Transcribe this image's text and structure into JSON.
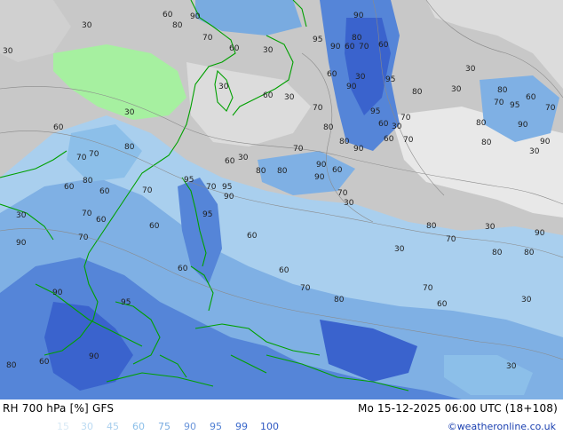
{
  "product": {
    "parameter": "RH 700 hPa [%]",
    "model": "GFS"
  },
  "valid_time": "Mo 15-12-2025 06:00 UTC (18+108)",
  "legend": {
    "values": [
      "15",
      "30",
      "45",
      "60",
      "75",
      "90",
      "95",
      "99",
      "100"
    ],
    "colors": [
      "#d8e9f5",
      "#bcdbf3",
      "#a9cfee",
      "#8cbfe9",
      "#79abe0",
      "#6a95da",
      "#4f7fd3",
      "#3968cb",
      "#2e58c2"
    ]
  },
  "credit": "©weatheronline.co.uk",
  "map": {
    "colors": {
      "dry": "#c8c8c8",
      "very_dry": "#dcdcdc",
      "moist_light": "#a9cfee",
      "moist_mid": "#7fb0e4",
      "moist_high": "#5585d8",
      "saturated": "#3a63cd",
      "landmass_highlight": "#a6f0a0",
      "coastline": "#00a000"
    },
    "contour_labels": [
      "60",
      "90",
      "30",
      "80",
      "90",
      "30",
      "70",
      "60",
      "30",
      "95",
      "90",
      "60",
      "70",
      "60",
      "30",
      "80",
      "60",
      "30",
      "90",
      "30",
      "70",
      "60",
      "95",
      "80",
      "30",
      "80",
      "70",
      "95",
      "60",
      "70",
      "80",
      "30",
      "70",
      "95",
      "60",
      "30",
      "90",
      "80",
      "60",
      "30",
      "70",
      "80",
      "90",
      "60",
      "80",
      "90",
      "80",
      "30",
      "60",
      "95",
      "70",
      "90",
      "80",
      "60",
      "70",
      "30",
      "70",
      "80",
      "90",
      "70",
      "60",
      "95",
      "70",
      "30",
      "60",
      "70",
      "90",
      "60",
      "80",
      "70",
      "95",
      "30",
      "60",
      "90",
      "80",
      "60",
      "70",
      "30",
      "80",
      "70",
      "60",
      "30",
      "90",
      "80",
      "60",
      "70",
      "95",
      "90",
      "80",
      "60",
      "70",
      "30",
      "90",
      "80",
      "60",
      "30"
    ]
  }
}
